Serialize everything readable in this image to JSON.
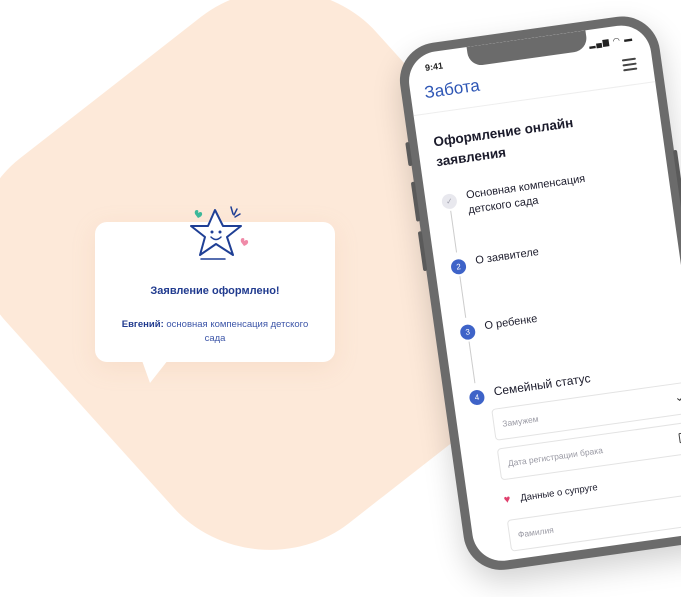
{
  "bubble": {
    "title": "Заявление оформлено!",
    "name": "Евгений:",
    "text": "основная компенсация детского сада"
  },
  "phone": {
    "status_time": "9:41",
    "app_title": "Забота",
    "form_title": "Оформление онлайн заявления",
    "steps": [
      {
        "num": "",
        "label": "Основная компенсация детского сада",
        "state": "done"
      },
      {
        "num": "2",
        "label": "О заявителе",
        "state": "pending"
      },
      {
        "num": "3",
        "label": "О ребенке",
        "state": "pending"
      },
      {
        "num": "4",
        "label": "Семейный статус",
        "state": "active"
      }
    ],
    "marital_select": {
      "placeholder": "Замужем"
    },
    "marriage_date": {
      "placeholder": "Дата регистрации брака"
    },
    "spouse_section": {
      "label": "Данные о супруге"
    },
    "surname": {
      "placeholder": "Фамилия"
    }
  },
  "colors": {
    "accent": "#3e63c8",
    "title_blue": "#2e56b5",
    "background_blob": "#fde9d9",
    "heart": "#e0406d"
  }
}
